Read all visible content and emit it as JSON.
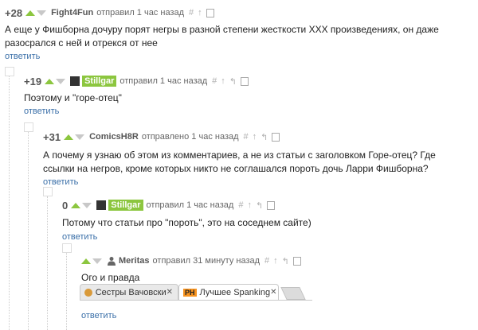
{
  "comments": [
    {
      "rating": "+28",
      "author": "Fight4Fun",
      "meta": "отправил 1 час назад",
      "text": "А еще у Фишборна дочуру порят негры в разной степени жесткости XXX произведениях, он даже разосрался с ней и отрекся от нее",
      "reply": "ответить"
    },
    {
      "rating": "+19",
      "author": "Stillgar",
      "meta": "отправил 1 час назад",
      "text": "Поэтому и \"горе-отец\"",
      "reply": "ответить"
    },
    {
      "rating": "+31",
      "author": "ComicsH8R",
      "meta": "отправлено 1 час назад",
      "text": "А почему я узнаю об этом из комментариев, а не из статьи с заголовком Горе-отец? Где ссылки на негров, кроме которых никто не соглашался пороть дочь Ларри Фишборна?",
      "reply": "ответить"
    },
    {
      "rating": "0",
      "author": "Stillgar",
      "meta": "отправил 1 час назад",
      "text": "Потому что статьи про \"пороть\", это на соседнем сайте)",
      "reply": "ответить"
    },
    {
      "rating": "",
      "author": "Meritas",
      "meta": "отправил 31 минуту назад",
      "text": "Ого и правда",
      "reply": "ответить"
    }
  ],
  "tools": {
    "hash": "#",
    "up": "↑",
    "back": "↰"
  },
  "browser_tabs": [
    {
      "label": "Сестры Вачовски",
      "icon": "orange-circle-icon"
    },
    {
      "label": "Лучшее Spanking",
      "icon_text": "PH"
    }
  ],
  "colors": {
    "upvote": "#8cc63f",
    "badge": "#8cc63f",
    "link": "#3a6fa8"
  }
}
